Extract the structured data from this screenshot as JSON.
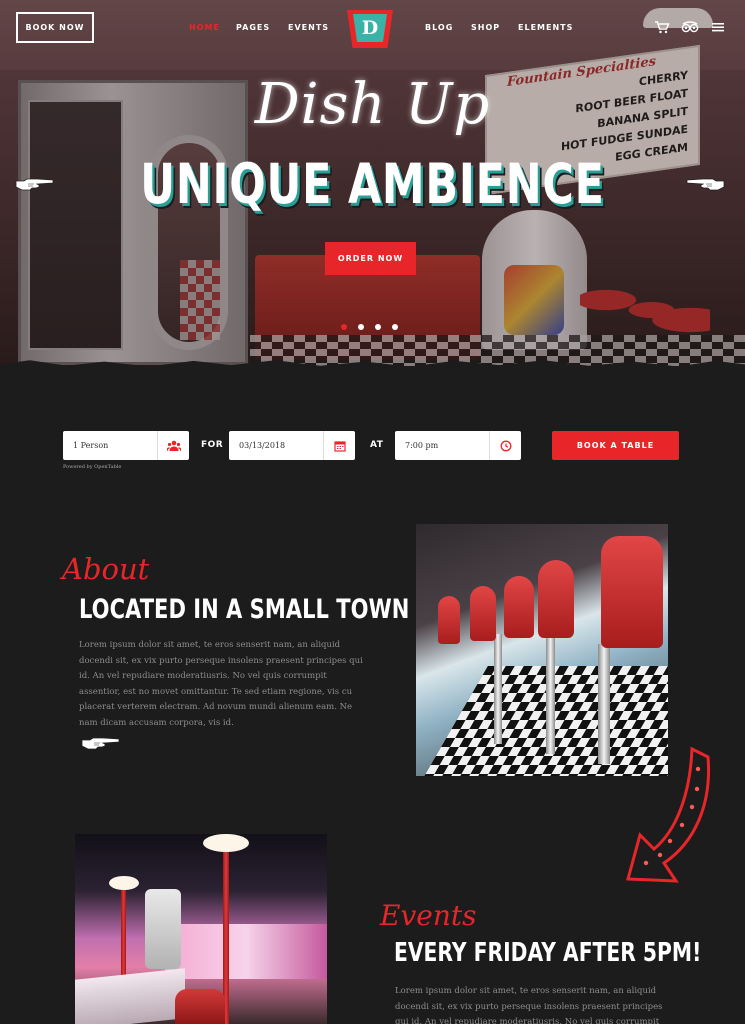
{
  "nav": {
    "book_now": "BOOK NOW",
    "items": [
      "HOME",
      "PAGES",
      "EVENTS",
      "BLOG",
      "SHOP",
      "ELEMENTS"
    ],
    "logo_letter": "D"
  },
  "hero": {
    "script_title": "Dish Up",
    "title": "UNIQUE AMBIENCE",
    "order_button": "ORDER NOW",
    "menu_board": [
      "Fountain Specialties",
      "CHERRY",
      "ROOT BEER FLOAT",
      "BANANA SPLIT",
      "HOT FUDGE SUNDAE",
      "EGG CREAM"
    ],
    "slides": 4,
    "active_slide": 1
  },
  "reservation": {
    "party": "1 Person",
    "for_label": "FOR",
    "date": "03/13/2018",
    "at_label": "AT",
    "time": "7:00 pm",
    "button": "BOOK A TABLE",
    "powered_by": "Powered by OpenTable"
  },
  "about": {
    "script": "About",
    "title": "LOCATED IN A SMALL TOWN",
    "text": "Lorem ipsum dolor sit amet, te eros senserit nam, an aliquid docendi sit, ex vix purto perseque insolens praesent principes qui id. An vel repudiare moderatiusris. No vel quis corrumpit assentior, est no movet omittantur. Te sed etiam regione, vis cu placerat verterem electram. Ad novum mundi alienum eam. Ne nam dicam accusam corpora, vis id."
  },
  "events": {
    "script": "Events",
    "title": "EVERY FRIDAY AFTER 5PM!",
    "text": "Lorem ipsum dolor sit amet, te eros senserit nam, an aliquid docendi sit, ex vix purto perseque insolens praesent principes qui id. An vel repudiare moderatiusris. No vel quis corrumpit assentior, est no movet"
  },
  "colors": {
    "accent": "#e8262a",
    "teal": "#39b3a8",
    "background": "#1c1c1c"
  },
  "icons": [
    "cart-icon",
    "tripadvisor-icon",
    "menu-icon",
    "hand-pointer-icon",
    "users-icon",
    "calendar-icon",
    "clock-icon",
    "neon-arrow-icon"
  ]
}
